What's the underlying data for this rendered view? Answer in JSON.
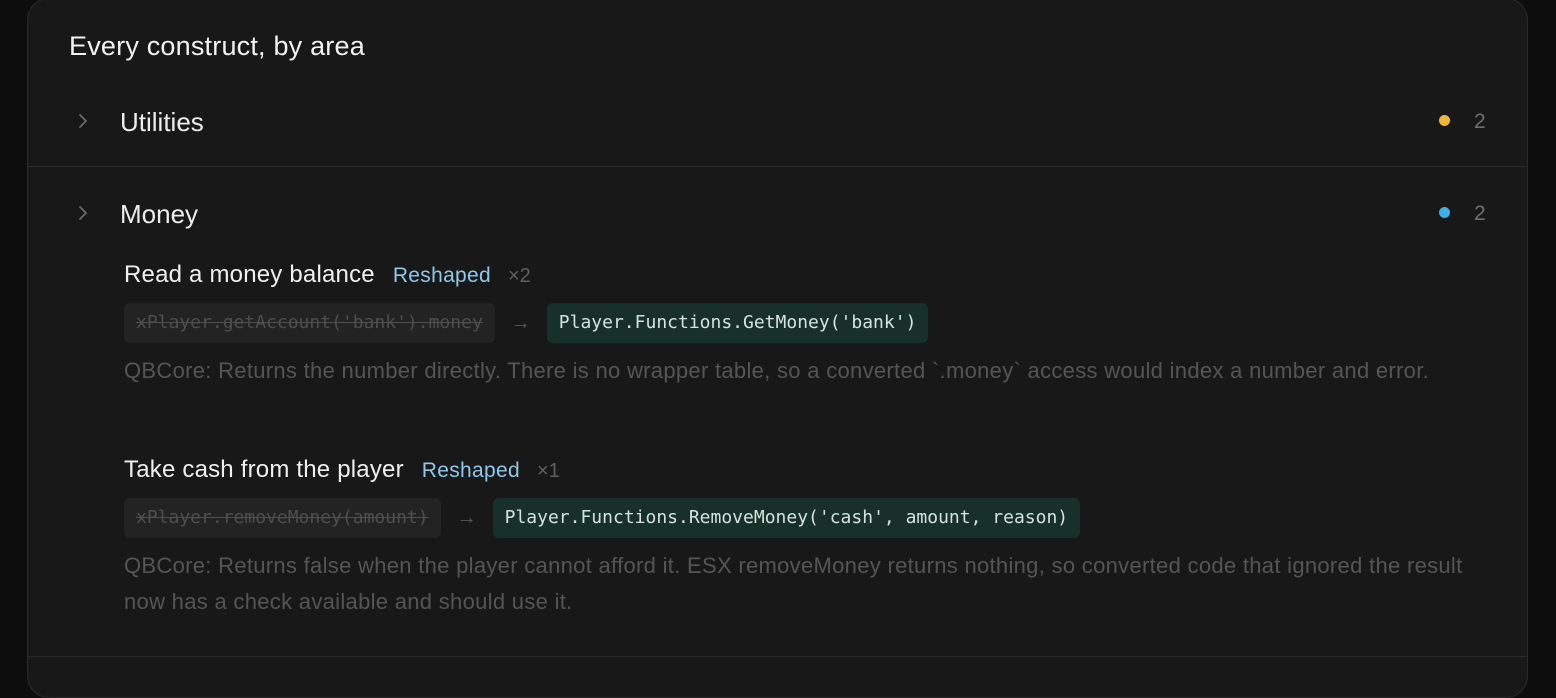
{
  "panel": {
    "title": "Every construct, by area"
  },
  "sections": [
    {
      "label": "Utilities",
      "count": "2",
      "dot_color": "#f2b534"
    },
    {
      "label": "Money",
      "count": "2",
      "dot_color": "#3ab0e8",
      "items": [
        {
          "title": "Read a money balance",
          "tag": "Reshaped",
          "multiplier": "×2",
          "old_code": "xPlayer.getAccount('bank').money",
          "arrow": "→",
          "new_code": "Player.Functions.GetMoney('bank')",
          "note": "QBCore: Returns the number directly. There is no wrapper table, so a converted `.money` access would index a number and error."
        },
        {
          "title": "Take cash from the player",
          "tag": "Reshaped",
          "multiplier": "×1",
          "old_code": "xPlayer.removeMoney(amount)",
          "arrow": "→",
          "new_code": "Player.Functions.RemoveMoney('cash', amount, reason)",
          "note": "QBCore: Returns false when the player cannot afford it. ESX removeMoney returns nothing, so converted code that ignored the result now has a check available and should use it."
        }
      ]
    }
  ],
  "icons": {
    "chevron": "chevron-right-icon",
    "dot": "status-dot-icon"
  }
}
